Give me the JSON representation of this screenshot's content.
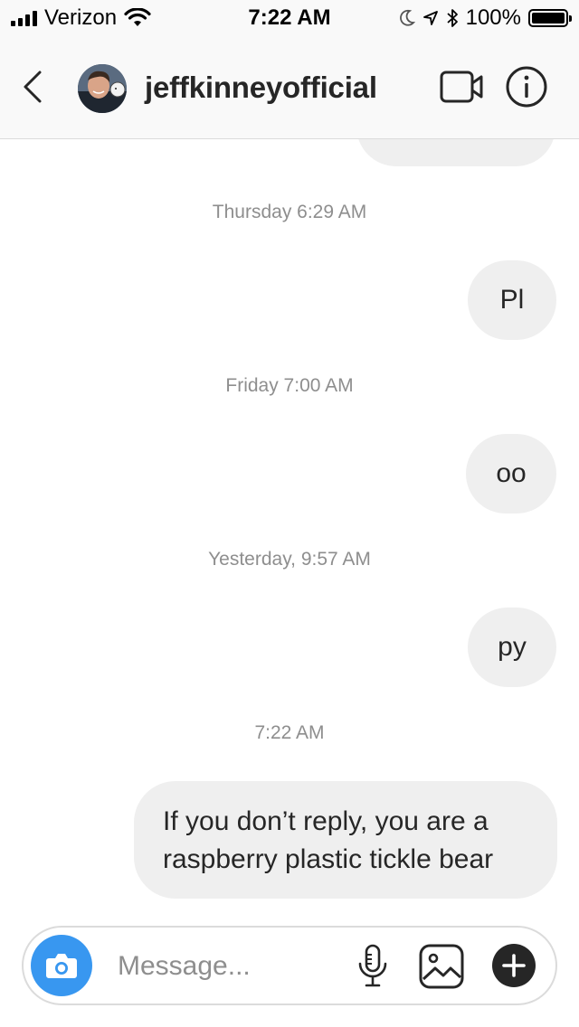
{
  "status_bar": {
    "carrier": "Verizon",
    "time": "7:22 AM",
    "battery": "100%",
    "battery_level": 1.0
  },
  "header": {
    "username": "jeffkinneyofficial",
    "icons": [
      "back-chevron-icon",
      "profile-avatar",
      "video-camera-icon",
      "info-icon"
    ]
  },
  "chat": {
    "messages": [
      {
        "type": "timestamp",
        "text": "Thursday 6:29 AM"
      },
      {
        "type": "outgoing",
        "text": "Pl"
      },
      {
        "type": "timestamp",
        "text": "Friday 7:00 AM"
      },
      {
        "type": "outgoing",
        "text": "oo"
      },
      {
        "type": "timestamp",
        "text": "Yesterday, 9:57 AM"
      },
      {
        "type": "outgoing",
        "text": "py"
      },
      {
        "type": "timestamp",
        "text": "7:22 AM"
      },
      {
        "type": "outgoing",
        "text_line1": "If you don’t reply, you are a",
        "text_line2": "raspberry plastic tickle bear"
      }
    ]
  },
  "composer": {
    "placeholder": "Message...",
    "icons": [
      "camera-icon",
      "microphone-icon",
      "gallery-icon",
      "plus-icon"
    ],
    "camera_color": "#3897f0"
  }
}
